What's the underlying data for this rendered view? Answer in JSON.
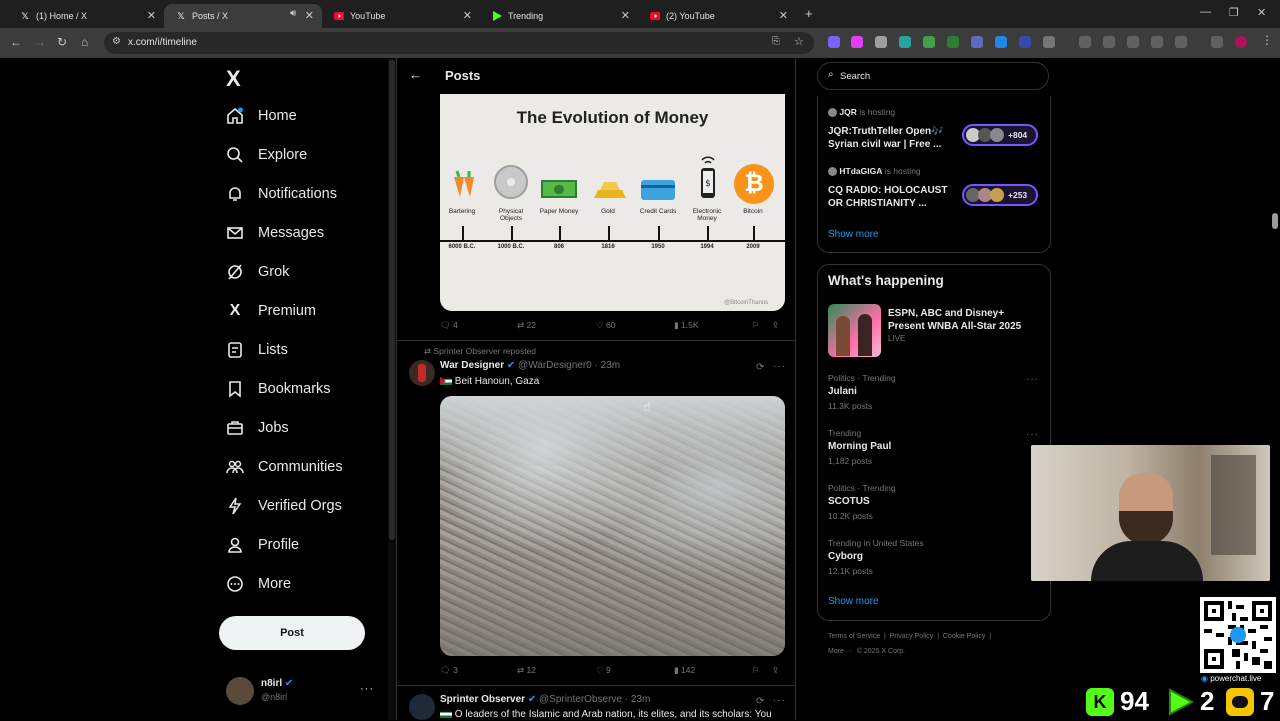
{
  "browser": {
    "tabs": [
      {
        "title": "(1) Home / X",
        "icon": "x-logo-icon"
      },
      {
        "title": "Posts / X",
        "icon": "x-logo-icon",
        "active": true
      },
      {
        "title": "YouTube",
        "icon": "youtube-icon"
      },
      {
        "title": "Trending",
        "icon": "play-icon"
      },
      {
        "title": "(2) YouTube",
        "icon": "youtube-icon"
      }
    ],
    "url": "x.com/i/timeline"
  },
  "sidebar": {
    "logo": "X",
    "items": [
      {
        "label": "Home"
      },
      {
        "label": "Explore"
      },
      {
        "label": "Notifications"
      },
      {
        "label": "Messages"
      },
      {
        "label": "Grok"
      },
      {
        "label": "Premium"
      },
      {
        "label": "Lists"
      },
      {
        "label": "Bookmarks"
      },
      {
        "label": "Jobs"
      },
      {
        "label": "Communities"
      },
      {
        "label": "Verified Orgs"
      },
      {
        "label": "Profile"
      },
      {
        "label": "More"
      }
    ],
    "post_label": "Post",
    "account": {
      "name": "n8irl",
      "handle": "@n8irl"
    }
  },
  "timeline": {
    "header_title": "Posts",
    "post1": {
      "image": {
        "title": "The Evolution of Money",
        "stages": [
          {
            "label": "Bartering",
            "year": "6000 B.C."
          },
          {
            "label": "Physical Objects",
            "year": "1000 B.C."
          },
          {
            "label": "Paper Money",
            "year": "806"
          },
          {
            "label": "Gold",
            "year": "1816"
          },
          {
            "label": "Credit Cards",
            "year": "1950"
          },
          {
            "label": "Electronic Money",
            "year": "1994"
          },
          {
            "label": "Bitcoin",
            "year": "2009"
          }
        ],
        "credit": "@BitcoinThanos"
      },
      "replies": "4",
      "reposts": "22",
      "likes": "60",
      "views": "1.5K"
    },
    "post2": {
      "repost_note": "Sprinter Observer reposted",
      "author": "War Designer",
      "handle": "@WarDesigner0",
      "time": "· 23m",
      "text": "Beit Hanoun, Gaza",
      "replies": "3",
      "reposts": "12",
      "likes": "9",
      "views": "142"
    },
    "post3": {
      "author": "Sprinter Observer",
      "handle": "@SprinterObserve",
      "time": "· 23m",
      "text": "O leaders of the Islamic and Arab nation, its elites, and its scholars: You"
    }
  },
  "right": {
    "search_placeholder": "Search",
    "spaces": [
      {
        "host": "JQR",
        "hosting": "is hosting",
        "title_line1": "JQR:TruthTeller Open🎶",
        "title_line2": "Syrian civil war | Free ...",
        "count": "+804"
      },
      {
        "host": "HTdaGIGA",
        "hosting": "is hosting",
        "title_line1": "CQ RADIO: HOLOCAUST",
        "title_line2": "OR CHRISTIANITY ...",
        "count": "+253"
      }
    ],
    "show_more_1": "Show more",
    "whats_happening": "What's happening",
    "featured": {
      "title_line1": "ESPN, ABC and Disney+",
      "title_line2": "Present WNBA All-Star 2025",
      "status": "LIVE"
    },
    "trends": [
      {
        "meta": "Politics · Trending",
        "title": "Julani",
        "count": "11.3K posts"
      },
      {
        "meta": "Trending",
        "title": "Morning Paul",
        "count": "1,182 posts"
      },
      {
        "meta": "Politics · Trending",
        "title": "SCOTUS",
        "count": "10.2K posts"
      },
      {
        "meta": "Trending in United States",
        "title": "Cyborg",
        "count": "12.1K posts"
      }
    ],
    "show_more_2": "Show more",
    "footer": {
      "links": [
        "Terms of Service",
        "Privacy Policy",
        "Cookie Policy"
      ],
      "more": "More ···",
      "copyright": "© 2025 X Corp."
    }
  },
  "overlay": {
    "brand": "powerchat.live",
    "counters": [
      {
        "value": "94",
        "color": "#53fc18"
      },
      {
        "value": "2",
        "color": "#53fc18"
      },
      {
        "value": "7",
        "color": "#f5c400"
      }
    ]
  },
  "colors": {
    "accent": "#1d9bf0",
    "bg": "#000000",
    "border": "#2f3336",
    "muted": "#71767b"
  }
}
